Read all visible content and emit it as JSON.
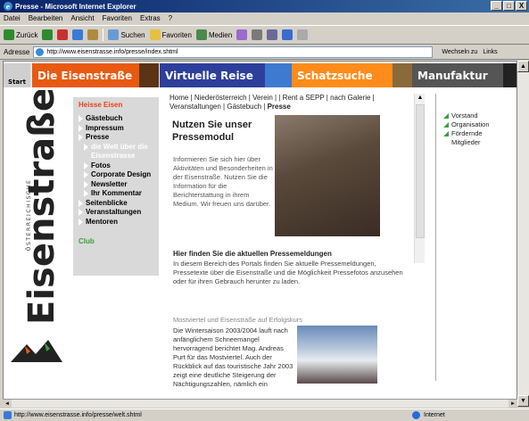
{
  "window": {
    "title": "Presse - Microsoft Internet Explorer",
    "minimize": "_",
    "maximize": "□",
    "close": "X"
  },
  "menu": [
    "Datei",
    "Bearbeiten",
    "Ansicht",
    "Favoriten",
    "Extras",
    "?"
  ],
  "toolbar": {
    "back": "Zurück",
    "search": "Suchen",
    "favorites": "Favoriten",
    "media": "Medien"
  },
  "address": {
    "label": "Adresse",
    "url": "http://www.eisenstrasse.info/presse/index.shtml",
    "go": "Wechseln zu",
    "links": "Links"
  },
  "nav": {
    "start": "Start",
    "tiles": [
      "Die Eisenstraße",
      "Virtuelle Reise",
      "Schatzsuche",
      "Manufaktur"
    ]
  },
  "logo": {
    "small": "ÖSTERREICHISCHE",
    "big": "Eisenstraße"
  },
  "leftnav": {
    "header": "Heisse Eisen",
    "items": [
      "Gästebuch",
      "Impressum",
      "Presse",
      "die Welt über die Eisenstrasse",
      "Fotos",
      "Corporate Design",
      "Newsletter",
      "Ihr Kommentar",
      "Seitenblicke",
      "Veranstaltungen",
      "Mentoren"
    ],
    "club": "Club"
  },
  "breadcrumb": {
    "path": "Home | Niederösterreich | Verein | | Rent a SEPP | nach Galerie | Veranstaltungen | Gästebuch |",
    "current": "Presse"
  },
  "main": {
    "title": "Nutzen Sie unser Pressemodul",
    "intro": "Informieren Sie sich hier über Aktivitäten und Besonderheiten in der Eisenstraße. Nutzen Sie die Information für die Berichterstattung in ihrem Medium. Wir freuen uns darüber.",
    "subheading": "Hier finden Sie die aktuellen Pressemeldungen",
    "body": "In diesem Bereich des Portals finden Sie aktuelle Pressemeldungen, Pressetexte über die Eisenstraße und die Möglichkeit Pressefotos anzusehen oder für ihren Gebrauch herunter zu laden.",
    "news_title": "Mostviertel und Eisenstraße auf Erfolgskurs",
    "news_text": "Die Wintersaison 2003/2004 lauft nach anfänglichem Schneemangel hervorragend berichtet Mag. Andreas Purt für das Mostviertel. Auch der Rückblick auf das touristische Jahr 2003 zeigt eine deutliche Steigerung der Nächtigungszahlen, nämlich ein"
  },
  "rightnav": [
    "Vorstand",
    "Organisation",
    "Fördernde Mitglieder"
  ],
  "status": {
    "url": "http://www.eisenstrasse.info/presse/welt.shtml",
    "zone": "Internet"
  }
}
